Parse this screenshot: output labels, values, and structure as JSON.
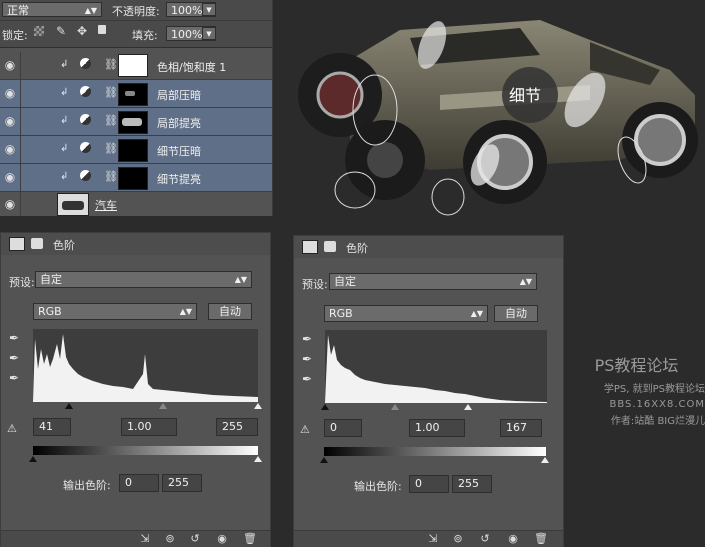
{
  "layers_panel": {
    "blend_mode": "正常",
    "opacity_label": "不透明度:",
    "opacity_value": "100%",
    "lock_label": "锁定:",
    "fill_label": "填充:",
    "fill_value": "100%",
    "layers": [
      {
        "name": "色相/饱和度 1",
        "selected": false
      },
      {
        "name": "局部压暗",
        "selected": true
      },
      {
        "name": "局部提亮",
        "selected": true
      },
      {
        "name": "细节压暗",
        "selected": true
      },
      {
        "name": "细节提亮",
        "selected": true
      },
      {
        "name": "汽车",
        "selected": false
      }
    ]
  },
  "photo_label": "细节",
  "levels_left": {
    "title": "色阶",
    "preset_label": "预设:",
    "preset_value": "自定",
    "channel": "RGB",
    "auto_label": "自动",
    "input_black": "41",
    "input_gamma": "1.00",
    "input_white": "255",
    "output_label": "输出色阶:",
    "output_black": "0",
    "output_white": "255"
  },
  "levels_right": {
    "title": "色阶",
    "preset_label": "预设:",
    "preset_value": "自定",
    "channel": "RGB",
    "auto_label": "自动",
    "input_black": "0",
    "input_gamma": "1.00",
    "input_white": "167",
    "output_label": "输出色阶:",
    "output_black": "0",
    "output_white": "255"
  },
  "watermark": {
    "line1": "PS教程论坛",
    "line2": "学PS, 就到PS教程论坛",
    "line3": "BBS.16XX8.COM",
    "line4": "作者:站酷 BIG烂漫儿"
  },
  "icons": {
    "eye": "eye-icon",
    "link": "chain-link-icon",
    "adjust": "adjustment-circle-icon",
    "eyedropper": "eyedropper-icon"
  }
}
